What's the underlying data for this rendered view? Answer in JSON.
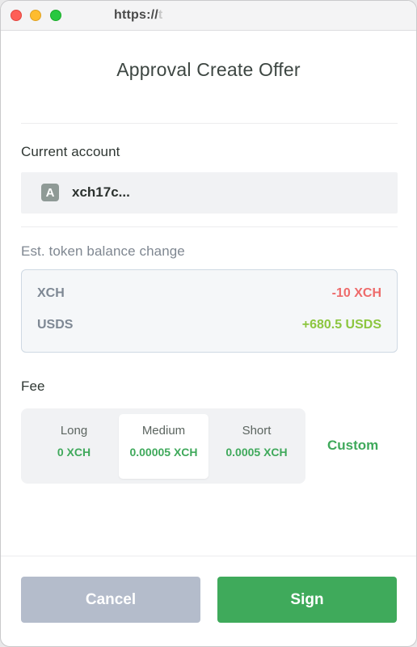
{
  "window": {
    "url_visible": "https://",
    "url_faded": "t"
  },
  "page": {
    "title": "Approval Create Offer"
  },
  "account": {
    "label": "Current account",
    "avatar_letter": "A",
    "name": "xch17c..."
  },
  "balance": {
    "label": "Est. token balance change",
    "rows": [
      {
        "token": "XCH",
        "change": "-10 XCH",
        "color": "#ee6b6b"
      },
      {
        "token": "USDS",
        "change": "+680.5 USDS",
        "color": "#8cc63f"
      }
    ]
  },
  "fee": {
    "label": "Fee",
    "options": [
      {
        "name": "Long",
        "value": "0 XCH",
        "selected": false
      },
      {
        "name": "Medium",
        "value": "0.00005 XCH",
        "selected": true
      },
      {
        "name": "Short",
        "value": "0.0005 XCH",
        "selected": false
      }
    ],
    "custom_label": "Custom"
  },
  "actions": {
    "cancel_label": "Cancel",
    "sign_label": "Sign"
  },
  "colors": {
    "accent_green": "#3faa5b",
    "cancel_grey": "#b4bccb",
    "negative_red": "#ee6b6b",
    "positive_green": "#8cc63f"
  }
}
